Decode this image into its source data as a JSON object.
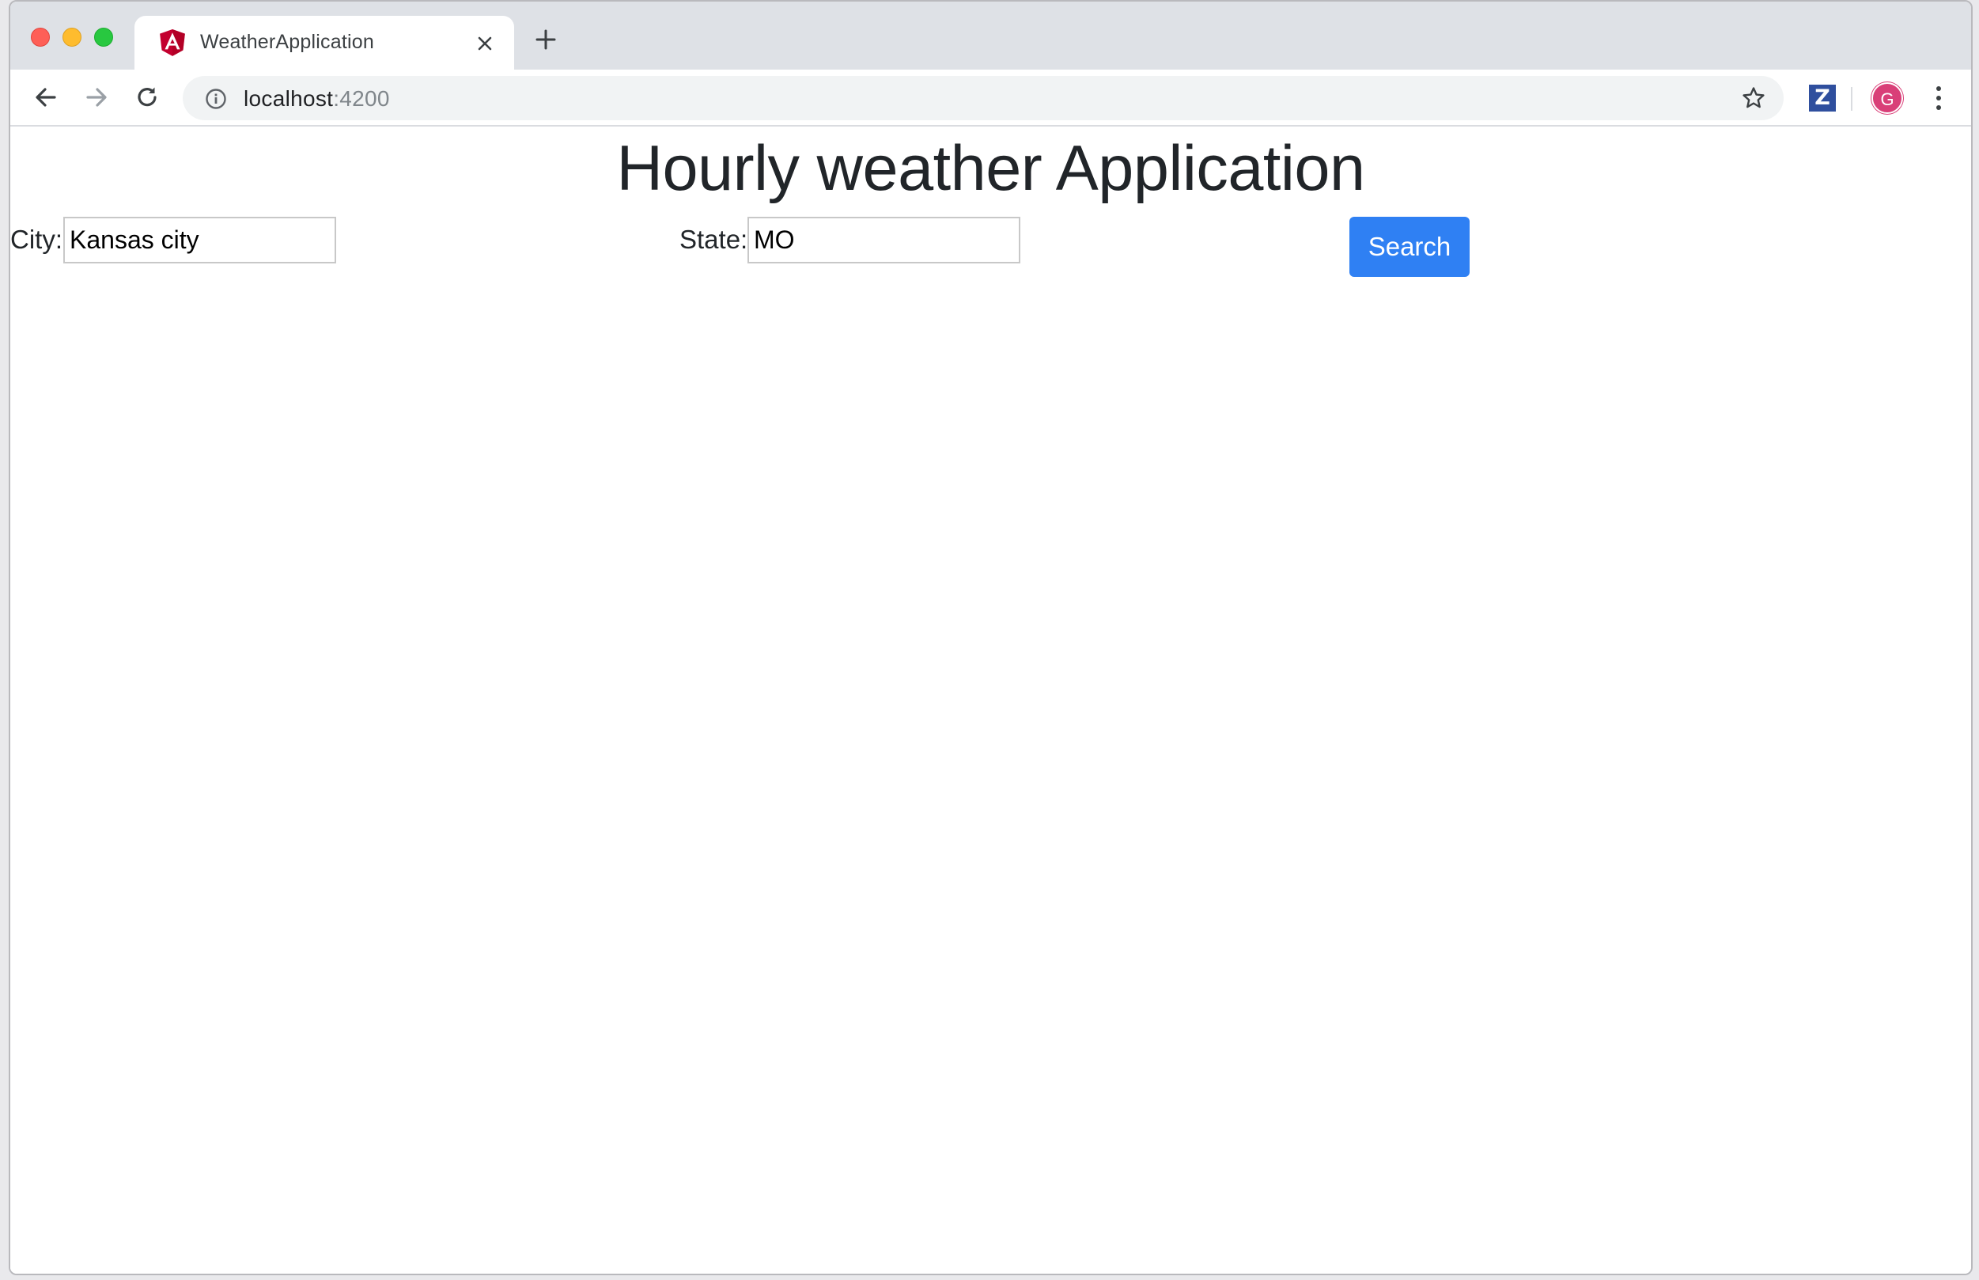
{
  "browser": {
    "tab": {
      "title": "WeatherApplication",
      "favicon": "angular-icon"
    },
    "address_bar": {
      "host": "localhost",
      "port": ":4200"
    },
    "extension_label": "Z",
    "profile_initial": "G",
    "colors": {
      "tab_strip": "#dee1e6",
      "profile_avatar": "#d93f78",
      "extension": "#2f4f9e"
    }
  },
  "app": {
    "title": "Hourly weather Application",
    "city": {
      "label": "City:",
      "value": "Kansas city"
    },
    "state": {
      "label": "State:",
      "value": "MO"
    },
    "search_button": "Search",
    "colors": {
      "primary_button": "#2f80f3",
      "heading_text": "#212529"
    }
  }
}
